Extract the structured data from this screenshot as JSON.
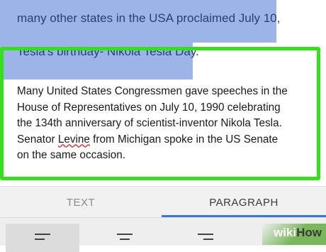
{
  "document": {
    "selected_lines": [
      "many other states in the USA proclaimed July 10,",
      "Tesla's birthday- Nikola Tesla Day."
    ],
    "paragraph_lines": [
      "Many United States Congressmen gave speeches in the",
      "House of Representatives on July 10, 1990 celebrating",
      "the 134th anniversary of scientist-inventor Nikola Tesla.",
      "Senator ",
      "Levine",
      " from Michigan spoke in the US Senate",
      "on the same occasion."
    ]
  },
  "tabs": {
    "text_label": "TEXT",
    "paragraph_label": "PARAGRAPH",
    "active": "PARAGRAPH"
  },
  "toolbar": {
    "buttons": [
      "align-left-icon",
      "align-center-icon",
      "align-right-icon"
    ],
    "active": "align-left-icon"
  },
  "watermark": {
    "wiki": "wiki",
    "how": "How"
  },
  "colors": {
    "selection": "#9cb4e8",
    "highlight_frame": "#33e01a",
    "tab_accent": "#3b78d8"
  }
}
